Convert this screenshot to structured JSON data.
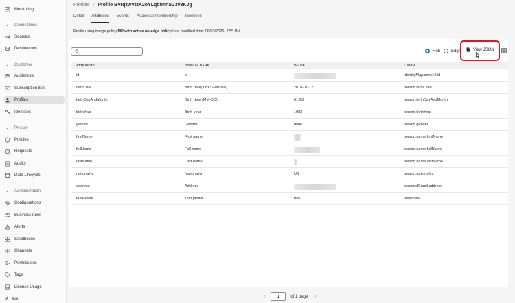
{
  "sidebar": {
    "monitoring": "Monitoring",
    "sections": {
      "connections": "Connections",
      "customer": "Customer",
      "privacy": "Privacy",
      "administration": "Administration"
    },
    "items": {
      "sources": "Sources",
      "destinations": "Destinations",
      "audiences": "Audiences",
      "subscription_lists": "Subscription lists",
      "profiles": "Profiles",
      "identities": "Identities",
      "policies": "Policies",
      "requests": "Requests",
      "audits": "Audits",
      "data_lifecycle": "Data Lifecycle",
      "configurations": "Configurations",
      "business_rules": "Business rules",
      "alerts": "Alerts",
      "sandboxes": "Sandboxes",
      "channels": "Channels",
      "permissions": "Permissions",
      "tags": "Tags",
      "license_usage": "License Usage"
    },
    "edit": "Edit"
  },
  "header": {
    "breadcrumb_parent": "Profiles",
    "breadcrumb_sep": "›",
    "title": "Profile BVrqzwVtzK2oYLqbfmnaG3v3KJg"
  },
  "tabs": [
    "Detail",
    "Attributes",
    "Events",
    "Audience membership",
    "Identities"
  ],
  "merge_info": {
    "prefix": "Profile using merge policy",
    "policy": "MP with active on-edge policy",
    "suffix": "Last modified time: 06/03/2026, 2:55 PM"
  },
  "toolbar": {
    "search_placeholder": "",
    "hub_label": "Hub",
    "edge_label": "Edge",
    "view_json_label": "View JSON"
  },
  "table": {
    "headers": {
      "attribute": "ATTRIBUTE",
      "display_name": "DISPLAY NAME",
      "value": "VALUE",
      "path": "PATH"
    },
    "rows": [
      {
        "attribute": "id",
        "display_name": "id",
        "value": "",
        "path": "identityMap.email.0.id"
      },
      {
        "attribute": "birthDate",
        "display_name": "Birth date(YYYY-MM-DD)",
        "value": "2018-01-12",
        "path": "person.birthDate"
      },
      {
        "attribute": "birthDayAndMonth",
        "display_name": "Birth date (MM-DD)",
        "value": "01-23",
        "path": "person.birthDayAndMonth"
      },
      {
        "attribute": "birthYear",
        "display_name": "Birth year",
        "value": "1983",
        "path": "person.birthYear"
      },
      {
        "attribute": "gender",
        "display_name": "Gender",
        "value": "male",
        "path": "person.gender"
      },
      {
        "attribute": "firstName",
        "display_name": "First name",
        "value": "",
        "path": "person.name.firstName"
      },
      {
        "attribute": "fullName",
        "display_name": "Full name",
        "value": "",
        "path": "person.name.fullName"
      },
      {
        "attribute": "lastName",
        "display_name": "Last name",
        "value": "",
        "path": "person.name.lastName"
      },
      {
        "attribute": "nationality",
        "display_name": "Nationality",
        "value": "US",
        "path": "person.nationality"
      },
      {
        "attribute": "address",
        "display_name": "Address",
        "value": "",
        "path": "personalEmail.address"
      },
      {
        "attribute": "testProfile",
        "display_name": "Test profile",
        "value": "true",
        "path": "testProfile"
      }
    ]
  },
  "pagination": {
    "page": "1",
    "of_label": "of 1 page",
    "prev": "‹",
    "next": "›"
  },
  "colors": {
    "highlight": "#e3141b",
    "radio_accent": "#1473e6"
  }
}
